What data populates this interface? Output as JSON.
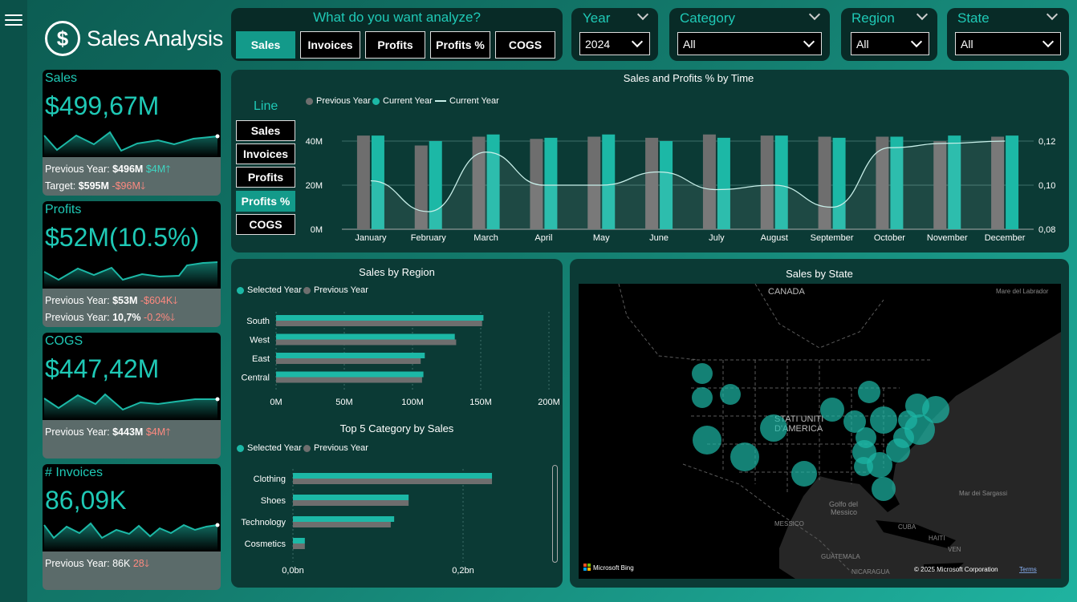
{
  "app": {
    "title": "Sales Analysis",
    "logo_icon": "$"
  },
  "analyze": {
    "prompt": "What do you want analyze?",
    "buttons": [
      "Sales",
      "Invoices",
      "Profits",
      "Profits %",
      "COGS"
    ]
  },
  "slicers": {
    "year": {
      "title": "Year",
      "value": "2024"
    },
    "category": {
      "title": "Category",
      "value": "All"
    },
    "region": {
      "title": "Region",
      "value": "All"
    },
    "state": {
      "title": "State",
      "value": "All"
    }
  },
  "kpis": {
    "sales": {
      "title": "Sales",
      "value": "$499,67M",
      "prev_label": "Previous Year:",
      "prev_value": "$496M",
      "prev_delta": "$4M",
      "target_label": "Target:",
      "target_value": "$595M",
      "target_delta": "-$96M"
    },
    "profits": {
      "title": "Profits",
      "value": "$52M(10.5%)",
      "prev_label": "Previous Year:",
      "prev_value": "$53M",
      "prev_delta": "-$604K",
      "prev2_label": "Previous Year:",
      "prev2_value": "10,7%",
      "prev2_delta": "-0.2%"
    },
    "cogs": {
      "title": "COGS",
      "value": "$447,42M",
      "prev_label": "Previous Year:",
      "prev_value": "$443M",
      "prev_delta": "$4M"
    },
    "invoices": {
      "title": "# Invoices",
      "value": "86,09K",
      "prev_label": "Previous Year:",
      "prev_value": "86K",
      "prev_delta": "28"
    }
  },
  "line_panel": {
    "title": "Line",
    "buttons": [
      "Sales",
      "Invoices",
      "Profits",
      "Profits %",
      "COGS"
    ]
  },
  "colors": {
    "teal": "#1cb8a6",
    "grey": "#6e6e6e",
    "panel": "#0b3a35",
    "down": "#ff8a80"
  },
  "chart_data": [
    {
      "type": "bar",
      "title": "Sales and Profits % by Time",
      "legend": [
        "Previous Year",
        "Current Year",
        "Current Year"
      ],
      "categories": [
        "January",
        "February",
        "March",
        "April",
        "May",
        "June",
        "July",
        "August",
        "September",
        "October",
        "November",
        "December"
      ],
      "series": [
        {
          "name": "Previous Year",
          "values": [
            42.5,
            38,
            42,
            41,
            42,
            41.5,
            43,
            42.5,
            42,
            42,
            40,
            42
          ]
        },
        {
          "name": "Current Year",
          "values": [
            42.5,
            40,
            43,
            41.5,
            43,
            40,
            41.5,
            42.5,
            41.5,
            42,
            42.5,
            42.5
          ]
        }
      ],
      "line": {
        "name": "Current Year",
        "values": [
          0.102,
          0.088,
          0.115,
          0.1,
          0.1,
          0.106,
          0.098,
          0.1,
          0.09,
          0.117,
          0.119,
          0.12
        ]
      },
      "yticks_left": [
        "0M",
        "20M",
        "40M"
      ],
      "ylim": [
        0,
        48
      ],
      "yticks_right": [
        "0,08",
        "0,10",
        "0,12"
      ],
      "ylim_right": [
        0.08,
        0.124
      ]
    },
    {
      "type": "bar",
      "title": "Sales by Region",
      "legend": [
        "Selected Year",
        "Previous Year"
      ],
      "categories": [
        "South",
        "West",
        "East",
        "Central"
      ],
      "series": [
        {
          "name": "Selected Year",
          "values": [
            152,
            131,
            109,
            108
          ]
        },
        {
          "name": "Previous Year",
          "values": [
            151,
            132,
            106,
            107
          ]
        }
      ],
      "xticks": [
        "0M",
        "50M",
        "100M",
        "150M",
        "200M"
      ],
      "xlim": [
        0,
        200
      ]
    },
    {
      "type": "bar",
      "title": "Top 5 Category by Sales",
      "legend": [
        "Selected Year",
        "Previous Year"
      ],
      "categories": [
        "Clothing",
        "Shoes",
        "Technology",
        "Cosmetics"
      ],
      "series": [
        {
          "name": "Selected Year",
          "values": [
            0.234,
            0.136,
            0.119,
            0.014
          ]
        },
        {
          "name": "Previous Year",
          "values": [
            0.234,
            0.136,
            0.115,
            0.014
          ]
        }
      ],
      "xticks": [
        "0,0bn",
        "0,2bn"
      ],
      "xlim": [
        0,
        0.3
      ]
    }
  ],
  "map": {
    "title": "Sales by State",
    "labels": {
      "canada": "CANADA",
      "usa1": "STATI UNITI",
      "usa2": "D'AMERICA",
      "mexico": "MESSICO",
      "gulf1": "Golfo del",
      "gulf2": "Messico",
      "labrador": "Mare del Labrador",
      "sargasso": "Mar dei Sargassi",
      "cuba": "CUBA",
      "haiti": "HAITI",
      "guatemala": "GUATEMALA",
      "nicaragua": "NICARAGUA",
      "ven": "VEN"
    },
    "bing": "Microsoft Bing",
    "copyright": "© 2025 Microsoft Corporation",
    "terms": "Terms"
  }
}
